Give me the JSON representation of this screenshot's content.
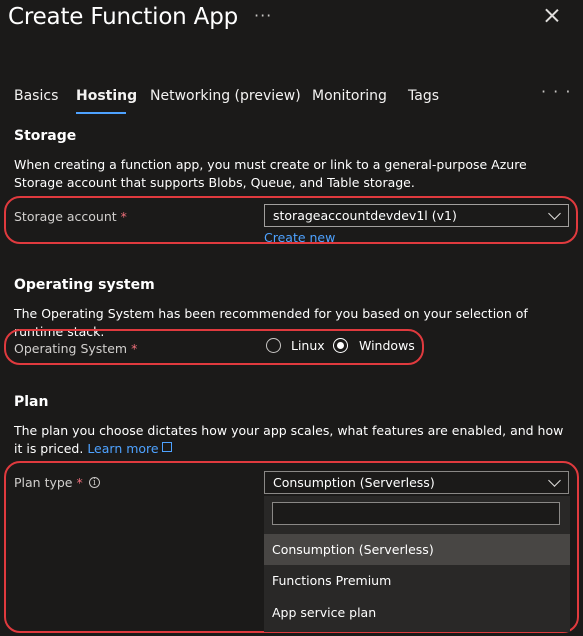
{
  "header": {
    "title": "Create Function App",
    "more": "···"
  },
  "tabs": [
    {
      "label": "Basics"
    },
    {
      "label": "Hosting"
    },
    {
      "label": "Networking (preview)"
    },
    {
      "label": "Monitoring"
    },
    {
      "label": "Tags"
    }
  ],
  "tabs_more": "· · ·",
  "storage": {
    "heading": "Storage",
    "description": "When creating a function app, you must create or link to a general-purpose Azure Storage account that supports Blobs, Queue, and Table storage.",
    "account_label": "Storage account",
    "required_mark": "*",
    "account_value": "storageaccountdevdev1l (v1)",
    "create_new": "Create new"
  },
  "os": {
    "heading": "Operating system",
    "description": "The Operating System has been recommended for you based on your selection of runtime stack.",
    "label": "Operating System",
    "required_mark": "*",
    "options": [
      "Linux",
      "Windows"
    ],
    "selected": "Windows"
  },
  "plan": {
    "heading": "Plan",
    "description": "The plan you choose dictates how your app scales, what features are enabled, and how it is priced.",
    "learn_more": "Learn more",
    "label": "Plan type",
    "required_mark": "*",
    "info": "i",
    "value": "Consumption (Serverless)",
    "search_value": "",
    "options": [
      "Consumption (Serverless)",
      "Functions Premium",
      "App service plan"
    ]
  },
  "colors": {
    "accent": "#4ea2ff",
    "highlight": "#e03a3e",
    "background": "#1b1a19"
  }
}
